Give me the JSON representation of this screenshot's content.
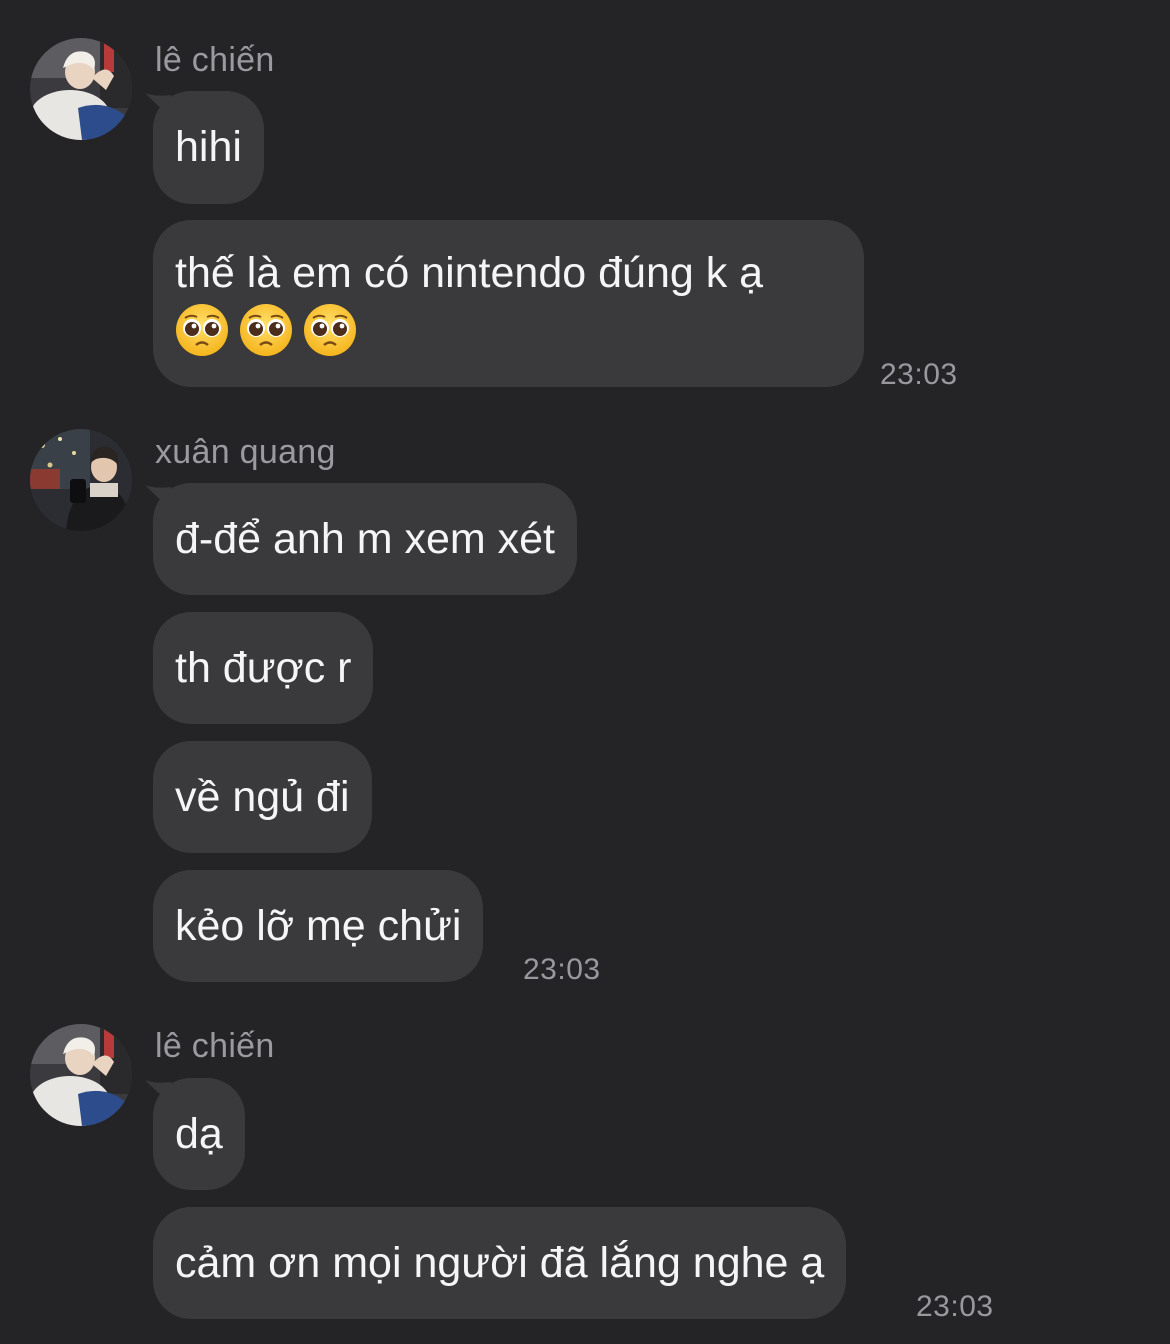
{
  "groups": [
    {
      "sender": "lê chiến",
      "avatar_icon": "avatar-le-chien-icon",
      "messages": [
        {
          "text": "hihi"
        },
        {
          "text": "thế là em có nintendo đúng k ạ",
          "emojis": [
            "pleading-face-emoji",
            "pleading-face-emoji",
            "pleading-face-emoji"
          ]
        }
      ],
      "time": "23:03"
    },
    {
      "sender": "xuân quang",
      "avatar_icon": "avatar-xuan-quang-icon",
      "messages": [
        {
          "text": "đ-để anh m xem xét"
        },
        {
          "text": "th được r"
        },
        {
          "text": "về ngủ đi"
        },
        {
          "text": "kẻo lỡ mẹ chửi"
        }
      ],
      "time": "23:03"
    },
    {
      "sender": "lê chiến",
      "avatar_icon": "avatar-le-chien-icon",
      "messages": [
        {
          "text": "dạ"
        },
        {
          "text": "cảm ơn mọi người đã lắng nghe ạ"
        }
      ],
      "time": "23:03"
    }
  ],
  "colors": {
    "background": "#242426",
    "bubble": "#3a3a3c",
    "text": "#f5f5f7",
    "meta": "#9a9a9f"
  }
}
